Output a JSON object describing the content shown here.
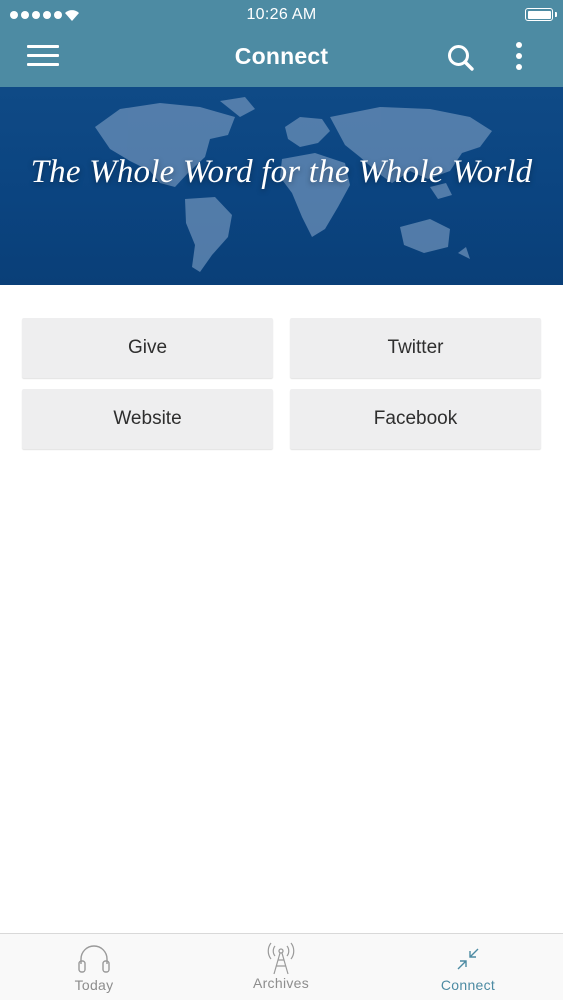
{
  "status_bar": {
    "time": "10:26 AM"
  },
  "nav": {
    "title": "Connect",
    "menu_icon": "hamburger-menu-icon",
    "search_icon": "search-icon",
    "more_icon": "more-vertical-icon"
  },
  "banner": {
    "text": "The Whole Word for the Whole World"
  },
  "links": [
    {
      "label": "Give"
    },
    {
      "label": "Twitter"
    },
    {
      "label": "Website"
    },
    {
      "label": "Facebook"
    }
  ],
  "tabs": [
    {
      "label": "Today",
      "icon": "headphones-icon",
      "active": false
    },
    {
      "label": "Archives",
      "icon": "radio-tower-icon",
      "active": false
    },
    {
      "label": "Connect",
      "icon": "collapse-arrows-icon",
      "active": true
    }
  ],
  "colors": {
    "accent": "#4d8ba3",
    "banner": "#0b4480",
    "tile": "#eeeeef",
    "inactive_tab": "#8d8d8d"
  }
}
